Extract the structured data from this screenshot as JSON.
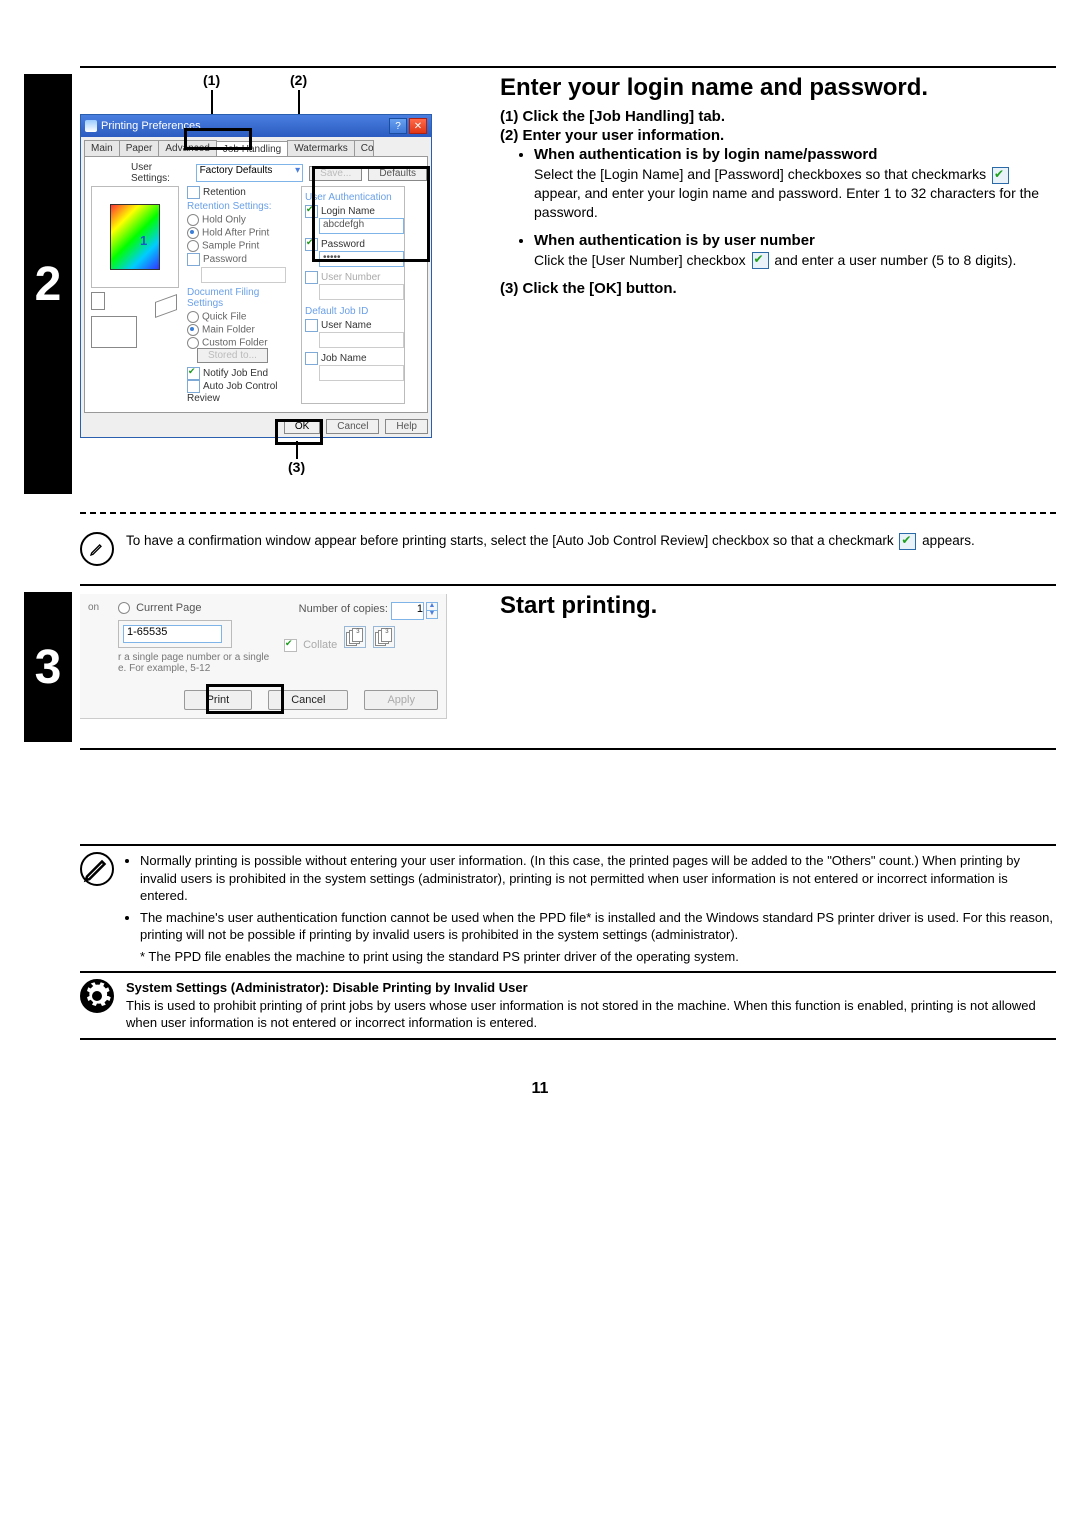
{
  "step2": {
    "number": "2",
    "callouts": {
      "one": "(1)",
      "two": "(2)",
      "three": "(3)"
    },
    "prefs_badge": "1",
    "heading": "Enter your login name and password.",
    "items": {
      "i1": "(1)  Click the [Job Handling] tab.",
      "i2": "(2)  Enter your user information.",
      "i3": "(3)  Click the [OK] button."
    },
    "sub": {
      "auth_login_title": "When authentication is by login name/password",
      "auth_login_body_pre": "Select the [Login Name] and [Password] checkboxes so that checkmarks ",
      "auth_login_body_post": " appear, and enter your login name and password. Enter 1 to 32 characters for the password.",
      "auth_user_title": "When authentication is by user number",
      "auth_user_body_pre": "Click the [User Number] checkbox ",
      "auth_user_body_post": " and enter a user number (5 to 8 digits)."
    },
    "dialog": {
      "title": "Printing Preferences",
      "tabs": [
        "Main",
        "Paper",
        "Advanced",
        "Job Handling",
        "Watermarks",
        "Color"
      ],
      "user_settings_label": "User Settings:",
      "user_settings_value": "Factory Defaults",
      "save_btn": "Save...",
      "defaults_btn": "Defaults",
      "retention_header": "Retention",
      "retention_settings": "Retention Settings:",
      "opts": {
        "hold_only": "Hold Only",
        "hold_after_print": "Hold After Print",
        "sample_print": "Sample Print",
        "password": "Password"
      },
      "df_header": "Document Filing Settings",
      "df_opts": {
        "quick_file": "Quick File",
        "main_folder": "Main Folder",
        "custom_folder": "Custom Folder"
      },
      "stored_to": "Stored to...",
      "notify": "Notify Job End",
      "auto_review": "Auto Job Control Review",
      "user_auth": "User Authentication",
      "login_name": "Login Name",
      "login_value": "abcdefgh",
      "password_label": "Password",
      "password_mask": "•••••",
      "user_number": "User Number",
      "default_job_id": "Default Job ID",
      "user_name": "User Name",
      "job_name": "Job Name",
      "ok": "OK",
      "cancel": "Cancel",
      "help": "Help"
    },
    "note_text_pre": "To have a confirmation window appear before printing starts, select the [Auto Job Control Review] checkbox so that a checkmark ",
    "note_text_post": " appears."
  },
  "step3": {
    "number": "3",
    "heading": "Start printing.",
    "dialog": {
      "current_page": "Current Page",
      "pages_value": "1-65535",
      "small_text_1": "r a single page number or a single",
      "small_text_2": "e. For example, 5-12",
      "copies_label": "Number of copies:",
      "copies_value": "1",
      "collate": "Collate",
      "print": "Print",
      "cancel": "Cancel",
      "apply": "Apply",
      "tail": "on"
    }
  },
  "footnote1": {
    "b1": "Normally printing is possible without entering your user information. (In this case, the printed pages will be added to the \"Others\" count.) When printing by invalid users is prohibited in the system settings (administrator), printing is not permitted when user information is not entered or incorrect information is entered.",
    "b2": "The machine's user authentication function cannot be used when the PPD file* is installed and the Windows standard PS printer driver is used. For this reason, printing will not be possible if printing by invalid users is prohibited in the system settings (administrator).",
    "star": "* The PPD file enables the machine to print using the standard PS printer driver of the operating system."
  },
  "footnote2": {
    "title": "System Settings (Administrator): Disable Printing by Invalid User",
    "body": "This is used to prohibit printing of print jobs by users whose user information is not stored in the machine. When this function is enabled, printing is not allowed when user information is not entered or incorrect information is entered."
  },
  "page_number": "11"
}
